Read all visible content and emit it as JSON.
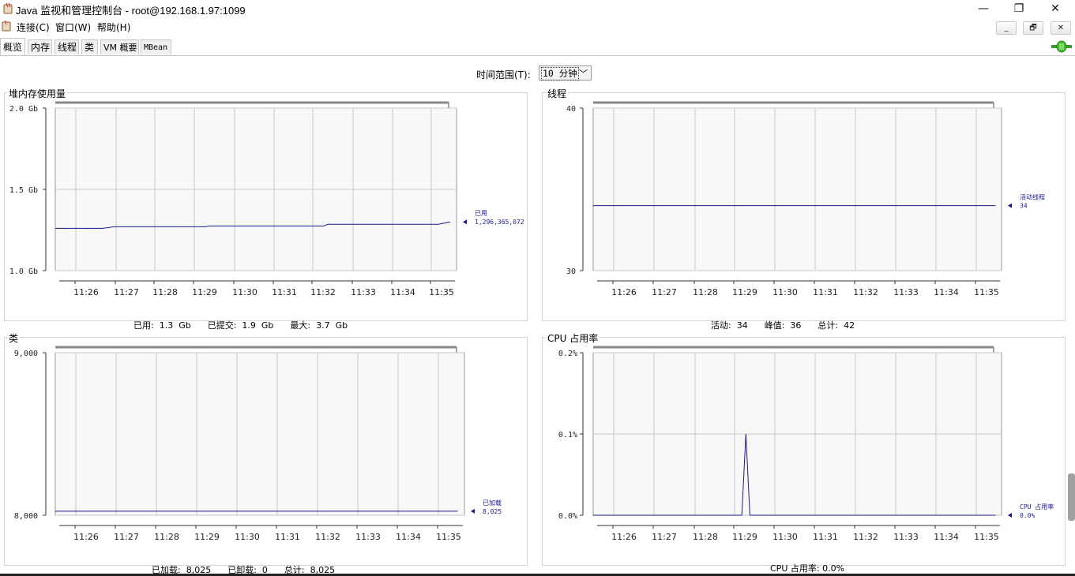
{
  "window": {
    "title": "Java 监视和管理控制台 - root@192.168.1.97:1099",
    "minimize_glyph": "—",
    "maximize_glyph": "❐",
    "close_glyph": "✕"
  },
  "menu": {
    "items": [
      {
        "label": "连接(C)"
      },
      {
        "label": "窗口(W)"
      },
      {
        "label": "帮助(H)"
      }
    ],
    "inner_min_glyph": "_",
    "inner_restore_glyph": "🗗",
    "inner_close_glyph": "✕"
  },
  "tabs": [
    {
      "label": "概览",
      "active": true
    },
    {
      "label": "内存"
    },
    {
      "label": "线程"
    },
    {
      "label": "类"
    },
    {
      "label": "VM 概要"
    },
    {
      "label": "MBean"
    }
  ],
  "range": {
    "label": "时间范围(T):",
    "value": "10 分钟"
  },
  "x_ticks": [
    "11:26",
    "11:27",
    "11:28",
    "11:29",
    "11:30",
    "11:31",
    "11:32",
    "11:33",
    "11:34",
    "11:35"
  ],
  "panels": {
    "heap": {
      "title": "堆内存使用量",
      "y_ticks": [
        "2.0 Gb",
        "1.5 Gb",
        "1.0 Gb"
      ],
      "legend_name": "已用",
      "legend_value": "1,296,365,072",
      "summary": [
        {
          "label": "已用:",
          "value": "1.3  Gb"
        },
        {
          "label": "已提交:",
          "value": "1.9  Gb"
        },
        {
          "label": "最大:",
          "value": "3.7  Gb"
        }
      ]
    },
    "threads": {
      "title": "线程",
      "y_ticks": [
        "40",
        "30"
      ],
      "legend_name": "活动线程",
      "legend_value": "34",
      "summary": [
        {
          "label": "活动:",
          "value": "34"
        },
        {
          "label": "峰值:",
          "value": "36"
        },
        {
          "label": "总计:",
          "value": "42"
        }
      ]
    },
    "classes": {
      "title": "类",
      "y_ticks": [
        "9,000",
        "8,000"
      ],
      "legend_name": "已加载",
      "legend_value": "8,025",
      "summary": [
        {
          "label": "已加载:",
          "value": "8,025"
        },
        {
          "label": "已卸载:",
          "value": "0"
        },
        {
          "label": "总计:",
          "value": "8,025"
        }
      ]
    },
    "cpu": {
      "title": "CPU 占用率",
      "y_ticks": [
        "0.2%",
        "0.1%",
        "0.0%"
      ],
      "legend_name": "CPU 占用率",
      "legend_value": "0.0%",
      "summary": [
        {
          "label": "CPU 占用率:",
          "value": "0.0%"
        }
      ]
    }
  },
  "chart_data": [
    {
      "type": "line",
      "title": "堆内存使用量",
      "x": [
        "11:25.5",
        "11:26.7",
        "11:27",
        "11:29.3",
        "11:29.4",
        "11:32.3",
        "11:32.4",
        "11:35.2",
        "11:35.5"
      ],
      "series": [
        {
          "name": "已用",
          "values": [
            1.26,
            1.26,
            1.27,
            1.27,
            1.275,
            1.275,
            1.285,
            1.285,
            1.3
          ]
        }
      ],
      "unit": "Gb",
      "ylim": [
        1.0,
        2.0
      ],
      "color": "#1a1a8c"
    },
    {
      "type": "line",
      "title": "线程",
      "x": [
        "11:25.5",
        "11:35.5"
      ],
      "series": [
        {
          "name": "活动线程",
          "values": [
            34,
            34
          ]
        }
      ],
      "ylim": [
        30,
        40
      ],
      "color": "#1a1a8c"
    },
    {
      "type": "line",
      "title": "类",
      "x": [
        "11:25.5",
        "11:35.5"
      ],
      "series": [
        {
          "name": "已加载",
          "values": [
            8025,
            8025
          ]
        }
      ],
      "ylim": [
        8000,
        9000
      ],
      "color": "#1a1a8c"
    },
    {
      "type": "line",
      "title": "CPU 占用率",
      "x": [
        "11:25.5",
        "11:29.2",
        "11:29.3",
        "11:29.4",
        "11:35.5"
      ],
      "series": [
        {
          "name": "CPU 占用率",
          "values": [
            0.0,
            0.0,
            0.1,
            0.0,
            0.0
          ]
        }
      ],
      "unit": "%",
      "ylim": [
        0.0,
        0.2
      ],
      "color": "#1a1a8c"
    }
  ]
}
